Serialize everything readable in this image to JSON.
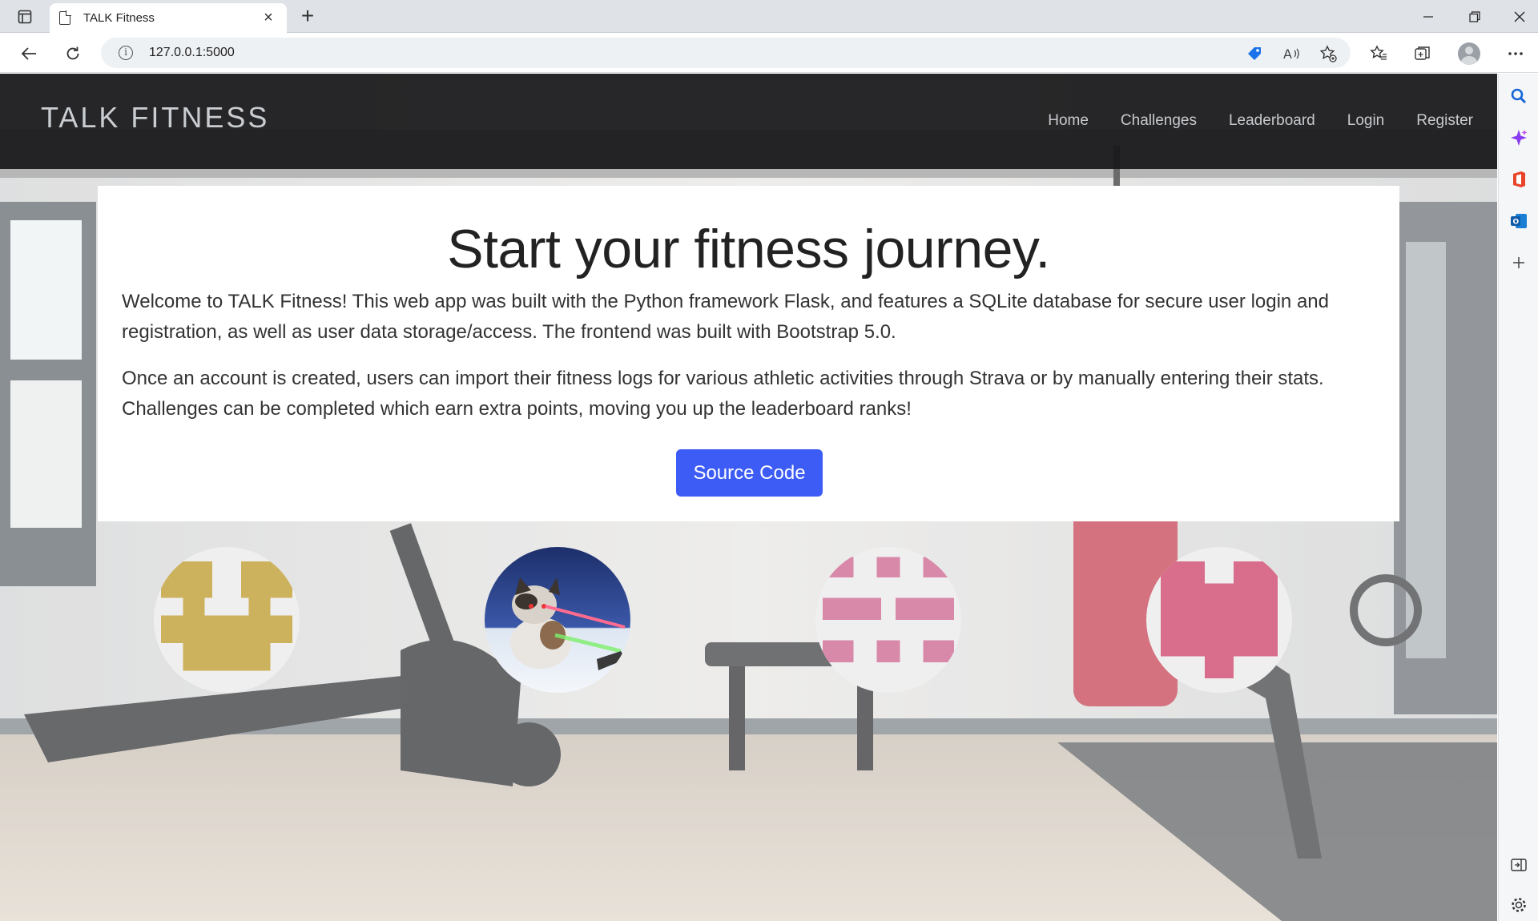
{
  "browser": {
    "tab_title": "TALK Fitness",
    "url": "127.0.0.1:5000",
    "new_tab_symbol": "+",
    "close_symbol": "×"
  },
  "site": {
    "brand": "TALK FITNESS",
    "nav": [
      "Home",
      "Challenges",
      "Leaderboard",
      "Login",
      "Register"
    ]
  },
  "hero": {
    "heading": "Start your fitness journey.",
    "paragraph1": "Welcome to TALK Fitness! This web app was built with the Python framework Flask, and features a SQLite database for secure user login and registration, as well as user data storage/access. The frontend was built with Bootstrap 5.0.",
    "paragraph2": "Once an account is created, users can import their fitness logs for various athletic activities through Strava or by manually entering their stats. Challenges can be completed which earn extra points, moving you up the leaderboard ranks!",
    "button": "Source Code"
  },
  "colors": {
    "button": "#3d5cf5",
    "identicon_gold": "#cdb25e",
    "identicon_pink_1": "#d889aa",
    "identicon_pink_2": "#d86e8c"
  },
  "avatars": [
    "gold-identicon",
    "cat-photo",
    "pink-identicon",
    "pink-identicon"
  ]
}
